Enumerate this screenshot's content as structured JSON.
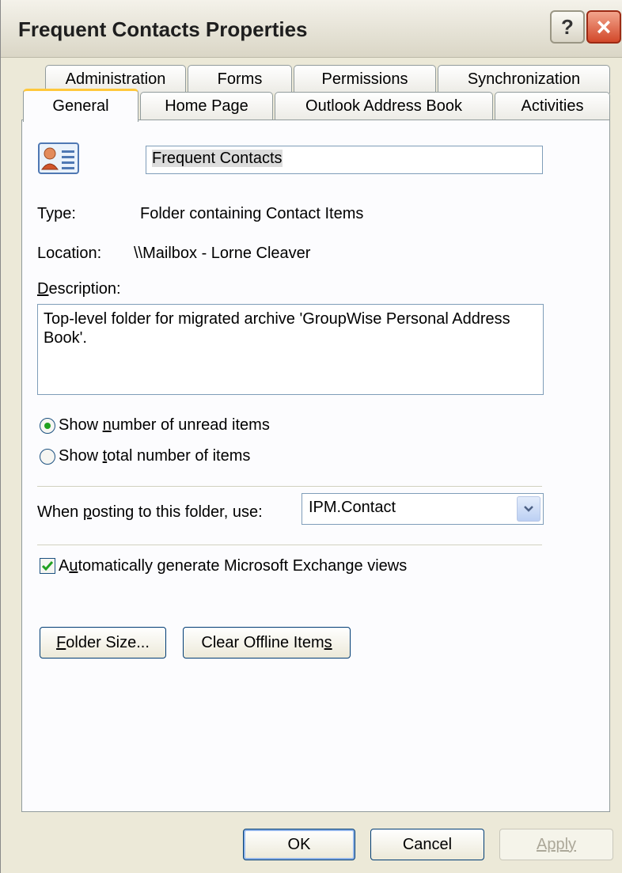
{
  "window": {
    "title": "Frequent Contacts Properties",
    "help_label": "?",
    "close_label": "×"
  },
  "tabs_top": [
    {
      "label": "Administration"
    },
    {
      "label": "Forms"
    },
    {
      "label": "Permissions"
    },
    {
      "label": "Synchronization"
    }
  ],
  "tabs_bottom": [
    {
      "label": "General",
      "active": true
    },
    {
      "label": "Home Page"
    },
    {
      "label": "Outlook Address Book"
    },
    {
      "label": "Activities"
    }
  ],
  "general": {
    "folder_name": "Frequent Contacts",
    "type_label": "Type:",
    "type_value": "Folder containing Contact Items",
    "location_label": "Location:",
    "location_value": "\\\\Mailbox - Lorne Cleaver",
    "description_label_pre": "",
    "description_label_u": "D",
    "description_label_post": "escription:",
    "description_value": "Top-level folder for migrated archive 'GroupWise Personal Address Book'.",
    "radio_unread_pre": "Show ",
    "radio_unread_u": "n",
    "radio_unread_post": "umber of unread items",
    "radio_unread_selected": true,
    "radio_total_pre": "Show ",
    "radio_total_u": "t",
    "radio_total_post": "otal number of items",
    "posting_label_pre": "When ",
    "posting_label_u": "p",
    "posting_label_post": "osting to this folder, use:",
    "posting_value": "IPM.Contact",
    "auto_views_pre": "A",
    "auto_views_u": "u",
    "auto_views_post": "tomatically generate Microsoft Exchange views",
    "auto_views_checked": true,
    "folder_size_u": "F",
    "folder_size_post": "older Size...",
    "clear_offline_pre": "Clear Offline Item",
    "clear_offline_u": "s"
  },
  "footer": {
    "ok": "OK",
    "cancel": "Cancel",
    "apply": "Apply"
  },
  "colors": {
    "dialog_bg": "#ece9d8",
    "active_tab_accent": "#ffc83c",
    "close_button": "#d2482a",
    "check_mark": "#21a121"
  }
}
